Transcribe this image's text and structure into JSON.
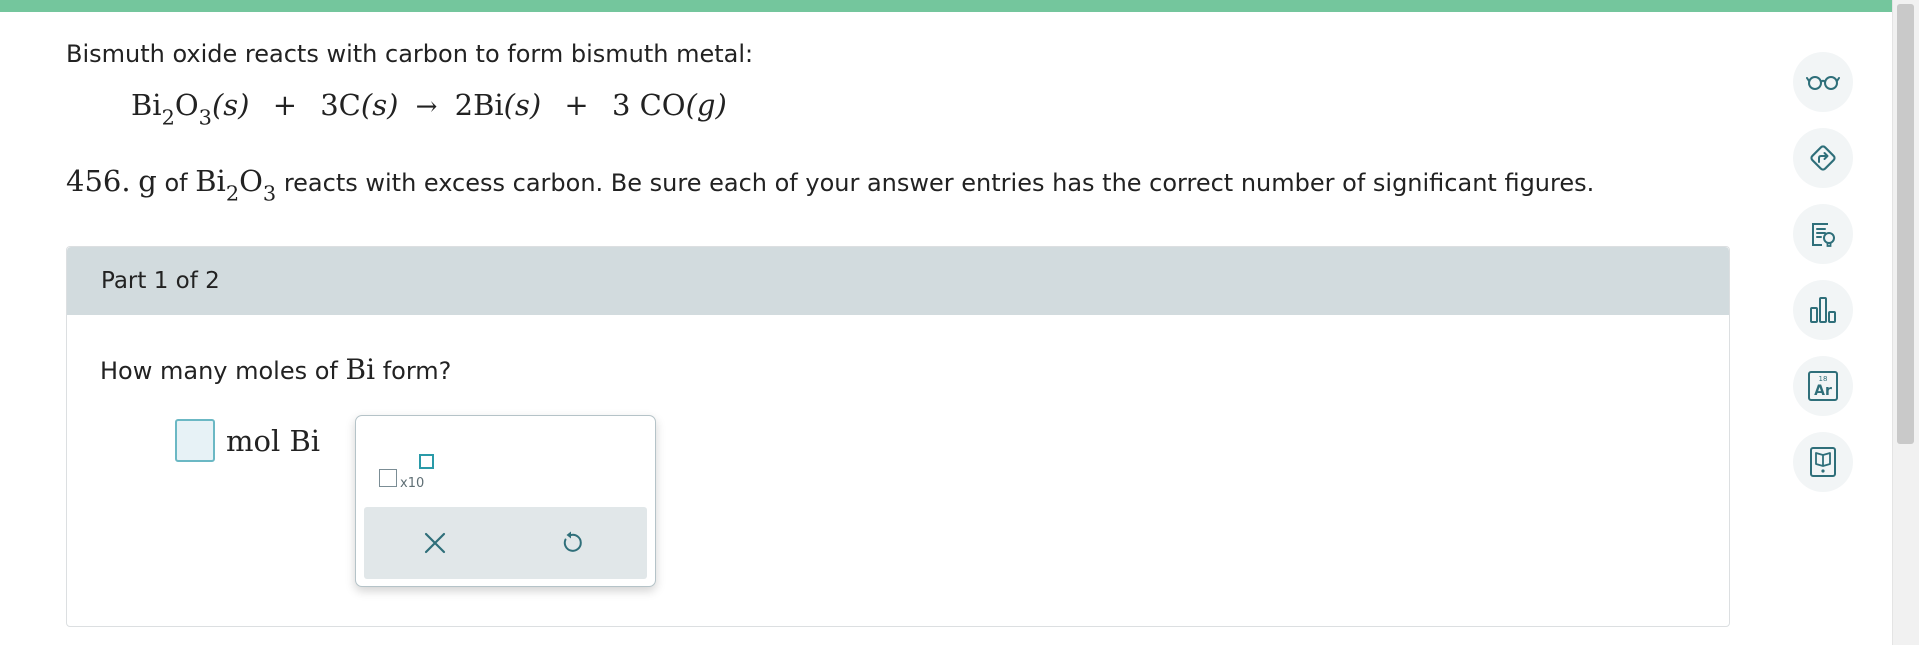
{
  "intro": {
    "text": "Bismuth oxide reacts with carbon to form bismuth metal:"
  },
  "equation": {
    "r1_el1": "Bi",
    "r1_sub1": "2",
    "r1_el2": "O",
    "r1_sub2": "3",
    "r1_state": "(s)",
    "plus1": "+",
    "r2": "3C",
    "r2_state": "(s)",
    "arrow": "→",
    "p1": "2Bi",
    "p1_state": "(s)",
    "plus2": "+",
    "p2": "3 CO",
    "p2_state": "(g)"
  },
  "given": {
    "number": "456.",
    "unit": "g",
    "of": "of",
    "f_el1": "Bi",
    "f_sub1": "2",
    "f_el2": "O",
    "f_sub2": "3",
    "rest": "reacts with excess carbon. Be sure each of your answer entries has the correct number of significant figures."
  },
  "part": {
    "title": "Part 1 of 2"
  },
  "question": {
    "prefix": "How many moles of",
    "formula": "Bi",
    "suffix": "form?"
  },
  "answer": {
    "unit_label": "mol Bi",
    "value": ""
  },
  "keypad": {
    "x10_label": "x10"
  },
  "toolbar": {
    "icons": [
      "glasses-icon",
      "direction-sign-icon",
      "explanation-icon",
      "bar-chart-icon",
      "periodic-table-icon",
      "textbook-icon"
    ]
  },
  "periodic_tile": {
    "number": "18",
    "symbol": "Ar"
  },
  "colors": {
    "accent_green": "#74c69d",
    "header_gray": "#d2dbde",
    "answer_teal": "#2a9aa8",
    "icon_teal": "#2f6f7a"
  }
}
